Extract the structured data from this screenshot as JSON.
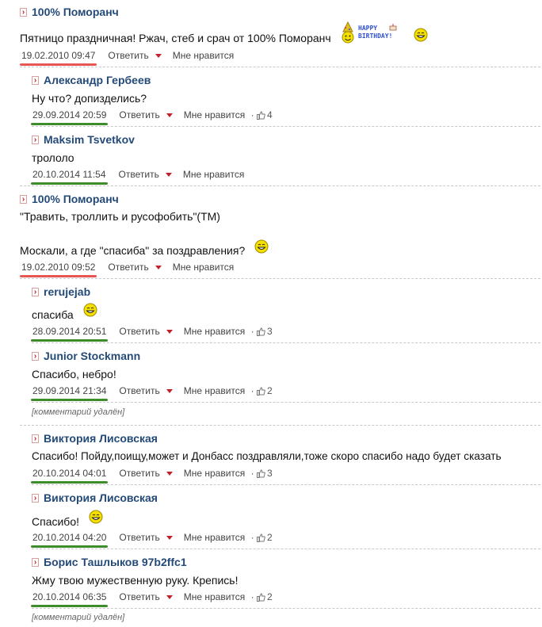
{
  "actions": {
    "reply": "Ответить",
    "like": "Мне нравится"
  },
  "colors": {
    "author": "#244a78",
    "underline_old": "#e85555",
    "underline_new": "#3e8c2a",
    "arrow": "#c0202a"
  },
  "icons": {
    "expand": "red-arrow-icon",
    "like": "thumbs-up-icon",
    "smiley": "smiley-icon",
    "birthday": "happy-birthday-icon"
  },
  "birthday_text": {
    "line1": "HAPPY",
    "line2": "BIRTHDAY!"
  },
  "comments": [
    {
      "author": "100% Поморанч",
      "text": "Пятницо праздничная! Ржач, стеб и срач от 100% Поморанч",
      "date": "19.02.2010 09:47",
      "likes": ""
    },
    {
      "author": "Александр Гербеев",
      "text": "Ну что? допизделись?",
      "date": "29.09.2014 20:59",
      "likes": "4"
    },
    {
      "author": "Maksim Tsvetkov",
      "text": "трололо",
      "date": "20.10.2014 11:54",
      "likes": ""
    },
    {
      "author": "100% Поморанч",
      "text": "\"Травить, троллить и русофобить\"(ТМ)",
      "text2": "Москали, а где \"спасиба\" за поздравления?",
      "date": "19.02.2010 09:52",
      "likes": ""
    },
    {
      "author": "rerujejab",
      "text": "спасиба",
      "date": "28.09.2014 20:51",
      "likes": "3"
    },
    {
      "author": "Junior Stockmann",
      "text": "Спасибо, небро!",
      "date": "29.09.2014 21:34",
      "likes": "2"
    },
    {
      "author": "Виктория Лисовская",
      "text": "Спасибо! Пойду,поищу,может и Донбасс поздравляли,тоже скоро спасибо надо будет сказать",
      "date": "20.10.2014 04:01",
      "likes": "3"
    },
    {
      "author": "Виктория Лисовская",
      "text": "Спасибо!",
      "date": "20.10.2014 04:20",
      "likes": "2"
    },
    {
      "author": "Борис Ташлыков 97b2ffc1",
      "text": "Жму твою мужественную руку. Крепись!",
      "date": "20.10.2014 06:35",
      "likes": "2"
    }
  ],
  "deleted_label": "[комментарий удалён]"
}
